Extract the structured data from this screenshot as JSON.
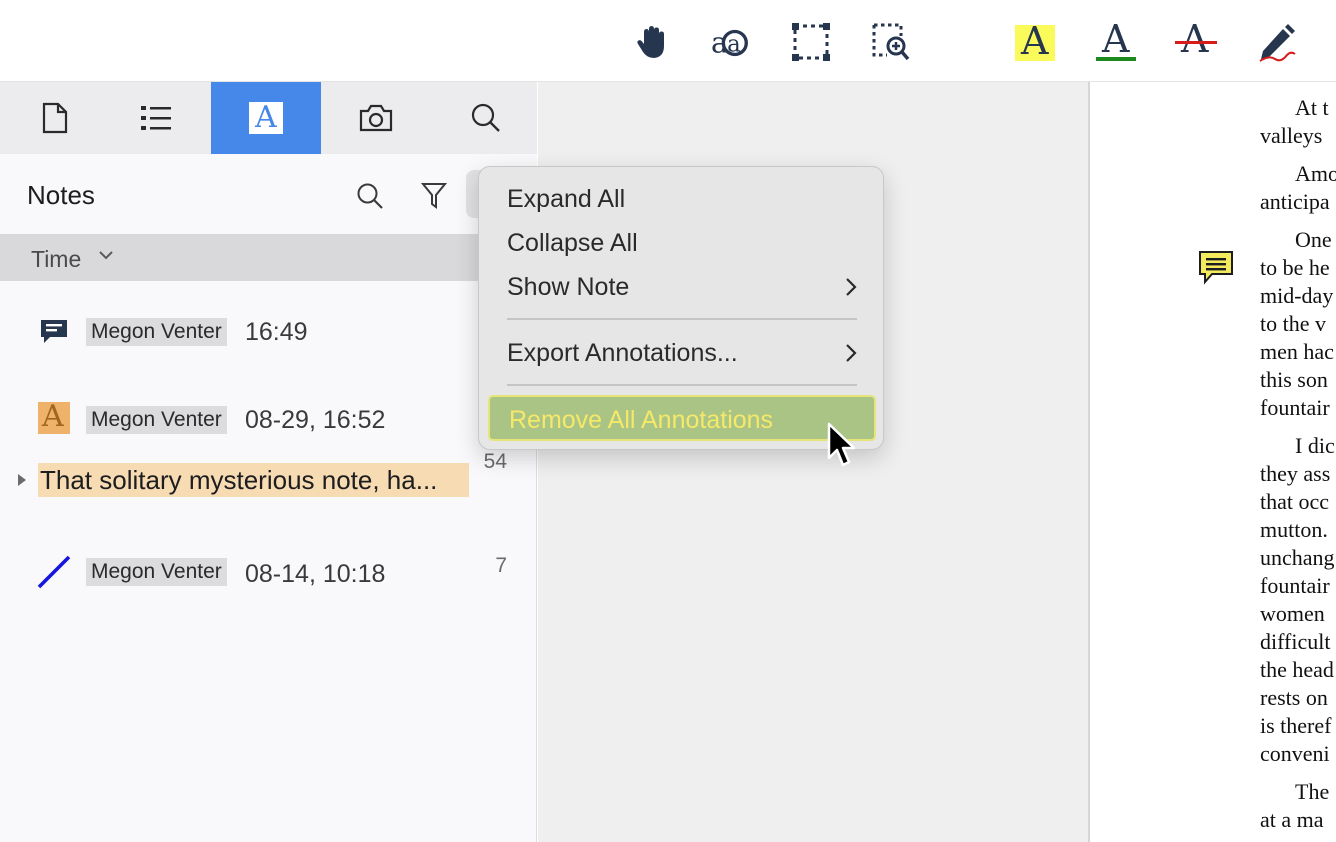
{
  "toolbar": {
    "tools": [
      {
        "name": "hand-tool",
        "icon": "hand-icon"
      },
      {
        "name": "text-select-tool",
        "icon": "text-select-icon"
      },
      {
        "name": "area-select-tool",
        "icon": "marquee-icon"
      },
      {
        "name": "zoom-area-tool",
        "icon": "zoom-marquee-icon"
      },
      {
        "name": "highlight-tool",
        "icon": "highlight-icon",
        "letter": "A",
        "color": "#fafa5a"
      },
      {
        "name": "underline-tool",
        "icon": "underline-icon",
        "letter": "A",
        "color": "#1e8a1e"
      },
      {
        "name": "strikethrough-tool",
        "icon": "strikethrough-icon",
        "letter": "A",
        "color": "#d81c1c"
      },
      {
        "name": "freehand-tool",
        "icon": "pen-icon"
      }
    ]
  },
  "sidebar": {
    "tabs": [
      {
        "name": "thumbnails",
        "icon": "page-icon",
        "active": false
      },
      {
        "name": "outline",
        "icon": "list-icon",
        "active": false
      },
      {
        "name": "annotations",
        "icon": "annotation-icon",
        "letter": "A",
        "active": true
      },
      {
        "name": "snapshots",
        "icon": "camera-icon",
        "active": false
      },
      {
        "name": "search",
        "icon": "search-icon",
        "active": false
      }
    ],
    "active_tab_color": "#4687ea",
    "notes_title": "Notes",
    "sort_label": "Time",
    "notes": [
      {
        "type": "comment",
        "icon": "comment-icon",
        "author": "Megon Venter",
        "time": "16:49",
        "page": ""
      },
      {
        "type": "highlight",
        "icon": "highlight-letter-icon",
        "letter": "A",
        "author": "Megon Venter",
        "time": "08-29, 16:52",
        "page": "54",
        "text": "That solitary mysterious note, ha..."
      },
      {
        "type": "line",
        "icon": "line-icon",
        "author": "Megon Venter",
        "time": "08-14, 10:18",
        "page": "7"
      }
    ]
  },
  "menu": {
    "items": [
      {
        "label": "Expand All",
        "submenu": false
      },
      {
        "label": "Collapse All",
        "submenu": false
      },
      {
        "label": "Show Note",
        "submenu": true
      },
      {
        "label": "Export Annotations...",
        "submenu": true
      },
      {
        "label": "Remove All Annotations",
        "submenu": false,
        "highlighted": true
      }
    ]
  },
  "document": {
    "lines": [
      "At t",
      "valleys",
      "Amo",
      "anticipa",
      "One",
      "to be he",
      "mid-day",
      "to the v",
      "men hac",
      "this son",
      "fountair",
      "I dic",
      "they ass",
      "that occ",
      "mutton.",
      "unchang",
      "fountair",
      "women",
      "difficult",
      "the head",
      "rests on",
      "is theref",
      "conveni",
      "The",
      "at a ma"
    ]
  }
}
